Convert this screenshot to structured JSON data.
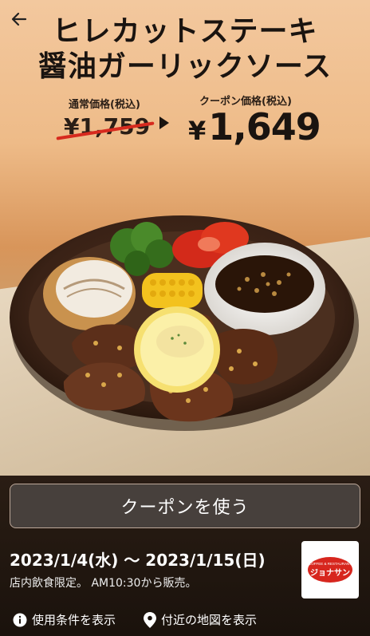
{
  "title": {
    "line1": "ヒレカットステーキ",
    "line2": "醤油ガーリックソース"
  },
  "regular": {
    "label": "通常価格(税込)",
    "price": "¥1,759"
  },
  "coupon": {
    "label": "クーポン価格(税込)",
    "yen": "¥",
    "price": "1,649"
  },
  "use_button": "クーポンを使う",
  "period": "2023/1/4(水) 〜 2023/1/15(日)",
  "note": "店内飲食限定。 AM10:30から販売。",
  "links": {
    "terms": "使用条件を表示",
    "map": "付近の地図を表示"
  },
  "logo": {
    "small": "COFFEE & RESTAURANT",
    "big": "ジョナサン"
  },
  "colors": {
    "strike": "#d72a1e",
    "button_bg": "#47403c",
    "logo_red": "#d7261e"
  }
}
